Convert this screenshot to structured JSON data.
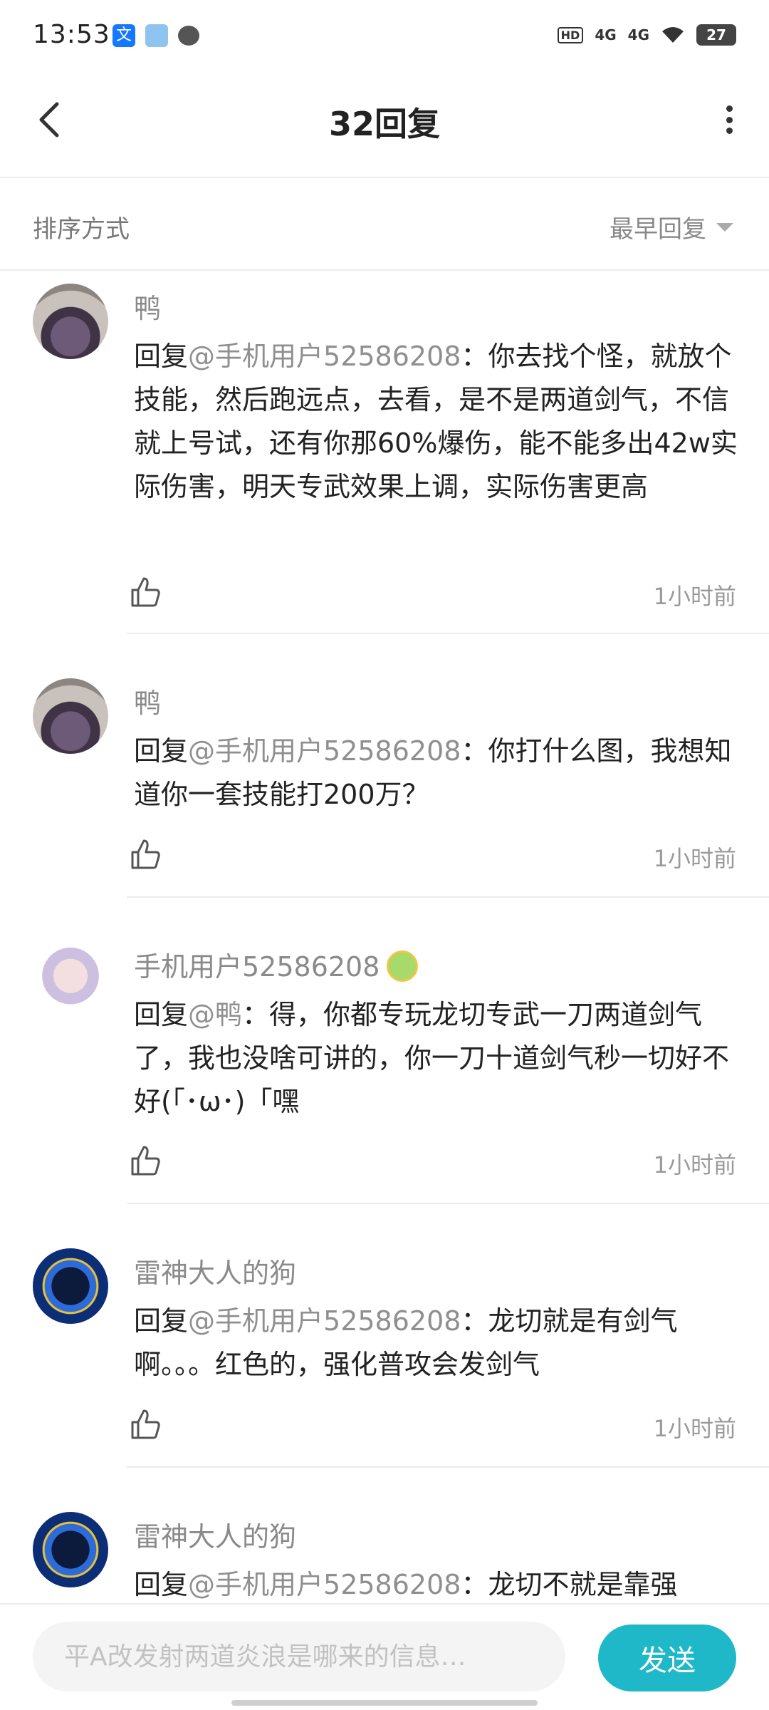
{
  "status_bar": {
    "time": "13:53",
    "app_icon_1": "文",
    "hd_badge": "HD",
    "network_1": "4G",
    "network_2": "4G",
    "battery": "27"
  },
  "header": {
    "title": "32回复"
  },
  "sort": {
    "label": "排序方式",
    "selected": "最早回复"
  },
  "replies": [
    {
      "author": "鸭",
      "prefix": "回复",
      "mention": "@手机用户52586208",
      "text": "：你去找个怪，就放个技能，然后跑远点，去看，是不是两道剑气，不信就上号试，还有你那60%爆伤，能不能多出42w实际伤害，明天专武效果上调，实际伤害更高",
      "time": "1小时前",
      "avatar": "duck-avatar"
    },
    {
      "author": "鸭",
      "prefix": "回复",
      "mention": "@手机用户52586208",
      "text": "：你打什么图，我想知道你一套技能打200万？",
      "time": "1小时前",
      "avatar": "duck-avatar"
    },
    {
      "author": "手机用户52586208",
      "prefix": "回复",
      "mention": "@鸭",
      "text": "：得，你都专玩龙切专武一刀两道剑气了，我也没啥可讲的，你一刀十道剑气秒一切好不好(「･ω･)「嘿",
      "time": "1小时前",
      "avatar": "anime-girl-avatar"
    },
    {
      "author": "雷神大人的狗",
      "prefix": "回复",
      "mention": "@手机用户52586208",
      "text": "：龙切就是有剑气啊。。。红色的，强化普攻会发剑气",
      "time": "1小时前",
      "avatar": "astronaut-avatar"
    },
    {
      "author": "雷神大人的狗",
      "prefix": "回复",
      "mention": "@手机用户52586208",
      "text": "：龙切不就是靠强",
      "time": "",
      "avatar": "astronaut-avatar"
    }
  ],
  "composer": {
    "placeholder": "平A改发射两道炎浪是哪来的信息…",
    "send_label": "发送"
  },
  "colors": {
    "accent": "#1fb8c9",
    "mention": "#8f8f8f",
    "divider": "#ececec"
  }
}
